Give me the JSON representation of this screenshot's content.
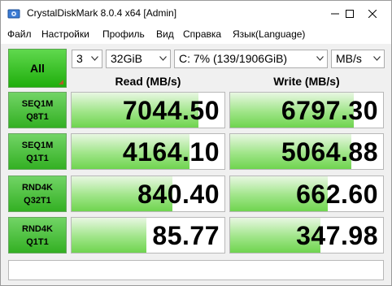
{
  "window": {
    "title": "CrystalDiskMark 8.0.4 x64 [Admin]"
  },
  "menu": [
    "Файл",
    "Настройки",
    "Профиль",
    "Вид",
    "Справка",
    "Язык(Language)"
  ],
  "controls": {
    "all_label": "All",
    "count": "3",
    "size": "32GiB",
    "drive": "C: 7% (139/1906GiB)",
    "unit": "MB/s"
  },
  "headers": {
    "read": "Read (MB/s)",
    "write": "Write (MB/s)"
  },
  "tests": [
    {
      "label1": "SEQ1M",
      "label2": "Q8T1",
      "read": "7044.50",
      "write": "6797.30",
      "read_fill": 0.83,
      "write_fill": 0.81
    },
    {
      "label1": "SEQ1M",
      "label2": "Q1T1",
      "read": "4164.10",
      "write": "5064.88",
      "read_fill": 0.77,
      "write_fill": 0.79
    },
    {
      "label1": "RND4K",
      "label2": "Q32T1",
      "read": "840.40",
      "write": "662.60",
      "read_fill": 0.66,
      "write_fill": 0.64
    },
    {
      "label1": "RND4K",
      "label2": "Q1T1",
      "read": "85.77",
      "write": "347.98",
      "read_fill": 0.49,
      "write_fill": 0.59
    }
  ],
  "comment": "",
  "colors": {
    "accent_green": "#33b023",
    "fill_green": "#6fd44f"
  }
}
